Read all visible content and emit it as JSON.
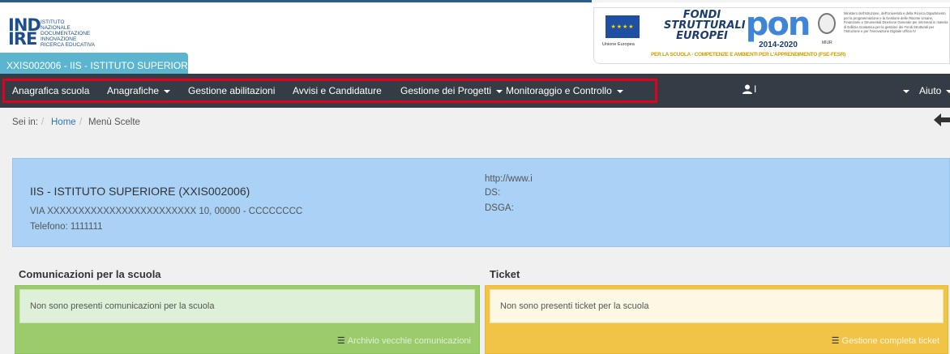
{
  "header": {
    "logo_mark": "IND\nIRE",
    "logo_lines": [
      "ISTITUTO",
      "NAZIONALE",
      "DOCUMENTAZIONE",
      "INNOVAZIONE",
      "RICERCA EDUCATIVA"
    ],
    "school_tab": "XXIS002006 - IIS - ISTITUTO SUPERIORE",
    "eu_caption": "Unione Europea",
    "fondi_line1": "FONDI",
    "fondi_line2": "STRUTTURALI",
    "fondi_line3": "EUROPEI",
    "pon_letters": "pon",
    "pon_years": "2014-2020",
    "pon_tag": "PER LA SCUOLA - COMPETENZE E AMBIENTI PER L'APPRENDIMENTO (FSE-FESR)",
    "miur": "MIUR",
    "ministry_text": "Ministero dell'Istruzione, dell'Università e della Ricerca Dipartimento per la programmazione e la Gestione delle Risorse Umane, Finanziarie e Strumentali Direzione Generale per interventi in materia di Edilizia Scolastica per la gestione dei Fondi Strutturali per l'Istruzione e per l'Innovazione Digitale Ufficio IV"
  },
  "nav": {
    "items": [
      {
        "label": "Anagrafica scuola"
      },
      {
        "label": "Anagrafiche"
      },
      {
        "label": "Gestione abilitazioni"
      },
      {
        "label": "Avvisi e Candidature"
      },
      {
        "label": "Gestione dei Progetti"
      },
      {
        "label": "Monitoraggio e Controllo"
      }
    ],
    "user_sep": "I",
    "help_label": "Aiuto"
  },
  "breadcrumb": {
    "prefix": "Sei in:",
    "home": "Home",
    "separator": "/",
    "current": "Menù Scelte"
  },
  "school": {
    "name": "IIS - ISTITUTO SUPERIORE (XXIS002006)",
    "address": "VIA XXXXXXXXXXXXXXXXXXXXXXXX 10, 00000 - CCCCCCCC",
    "phone": "Telefono: 1111111",
    "website": "http://www.i",
    "ds": "DS:",
    "dsga": "DSGA:"
  },
  "comunicazioni": {
    "title": "Comunicazioni per la scuola",
    "message": "Non sono presenti comunicazioni per la scuola",
    "link": "Archivio vecchie comunicazioni"
  },
  "ticket": {
    "title": "Ticket",
    "message": "Non sono presenti ticket per la scuola",
    "link": "Gestione completa ticket"
  },
  "colors": {
    "navbar": "#343d45",
    "highlight": "#e3001b",
    "school_card": "#a9d2f6",
    "green_panel": "#9bcb6b",
    "yellow_panel": "#f1c347",
    "tab": "#5bb5cf"
  }
}
